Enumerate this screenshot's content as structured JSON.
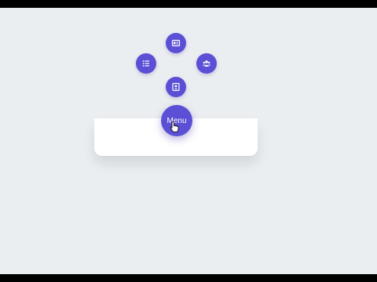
{
  "menu": {
    "label": "Menu",
    "accent": "#5b4fd6",
    "items": [
      {
        "icon": "id-card-icon"
      },
      {
        "icon": "list-icon"
      },
      {
        "icon": "users-icon"
      },
      {
        "icon": "user-badge-icon"
      }
    ]
  }
}
